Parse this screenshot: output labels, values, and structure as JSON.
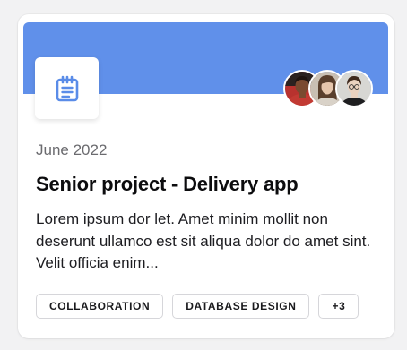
{
  "card": {
    "date": "June 2022",
    "title": "Senior project - Delivery app",
    "description": "Lorem ipsum dor let. Amet minim mollit non deserunt ullamco est sit aliqua dolor do amet sint. Velit officia enim...",
    "icon": "notepad-icon",
    "banner_color": "#6090ea",
    "icon_color": "#5a8ce8",
    "tags": [
      "COLLABORATION",
      "DATABASE DESIGN"
    ],
    "more_tags": "+3"
  },
  "avatars": [
    {
      "name": "avatar-1",
      "bg": "#b8322e",
      "skin": "#7a4a30",
      "hair": "#1f1410"
    },
    {
      "name": "avatar-2",
      "bg": "#c9bfb3",
      "skin": "#e6c6ac",
      "hair": "#5a3f2c"
    },
    {
      "name": "avatar-3",
      "bg": "#d7d7d3",
      "skin": "#ead2bf",
      "hair": "#3f2a1d"
    }
  ]
}
